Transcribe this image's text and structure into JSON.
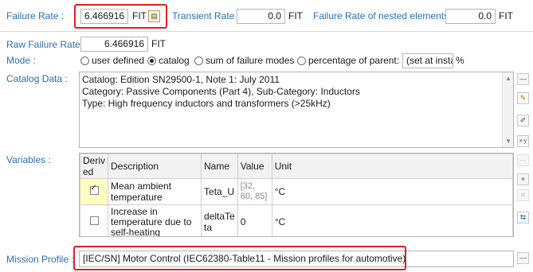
{
  "failure_rate": {
    "label": "Failure Rate :",
    "value": "6.466916",
    "unit": "FIT"
  },
  "transient_rate": {
    "label": "Transient Rate :",
    "value": "0.0",
    "unit": "FIT"
  },
  "nested_rate": {
    "label": "Failure Rate of nested elements :",
    "value": "0.0",
    "unit": "FIT"
  },
  "raw_failure_rate": {
    "label": "Raw Failure Rate :",
    "value": "6.466916",
    "unit": "FIT"
  },
  "mode": {
    "label": "Mode :",
    "options": [
      "user defined",
      "catalog",
      "sum of failure modes",
      "percentage of parent:"
    ],
    "selected": "catalog",
    "percentage_value": "(set at instan",
    "percent_sign": "%"
  },
  "catalog": {
    "label": "Catalog Data :",
    "lines": [
      "Catalog: Edition SN29500-1, Note 1: July 2011",
      "Category: Passive Components (Part 4), Sub-Category: Inductors",
      "Type: High frequency inductors and transformers (>25kHz)"
    ]
  },
  "variables": {
    "label": "Variables :",
    "headers": [
      "Deriv ed",
      "Description",
      "Name",
      "Value",
      "Unit"
    ],
    "rows": [
      {
        "derived": true,
        "description": "Mean ambient temperature",
        "name": "Teta_U",
        "value": "[32, 60, 85]",
        "unit": "°C"
      },
      {
        "derived": false,
        "description": "Increase in temperature due to self-heating",
        "name": "deltaTe ta",
        "value": "0",
        "unit": "°C"
      }
    ]
  },
  "mission_profile": {
    "label": "Mission Profile :",
    "value": "[IEC/SN] Motor Control (IEC62380-Table11 - Mission profiles for automotive)"
  },
  "colors": {
    "label_blue": "#2e6db4",
    "highlight_red": "#e02020",
    "selected_row": "#ffffc0"
  }
}
